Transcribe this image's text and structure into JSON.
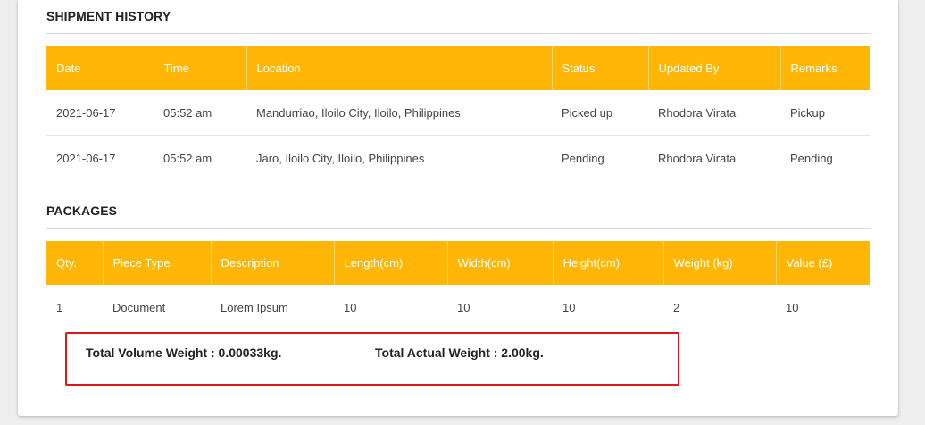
{
  "shipment_history": {
    "title": "SHIPMENT HISTORY",
    "columns": [
      "Date",
      "Time",
      "Location",
      "Status",
      "Updated By",
      "Remarks"
    ],
    "rows": [
      [
        "2021-06-17",
        "05:52 am",
        "Mandurriao, Iloilo City, Iloilo, Philippines",
        "Picked up",
        "Rhodora Virata",
        "Pickup"
      ],
      [
        "2021-06-17",
        "05:52 am",
        "Jaro, Iloilo City, Iloilo, Philippines",
        "Pending",
        "Rhodora Virata",
        "Pending"
      ]
    ]
  },
  "packages": {
    "title": "PACKAGES",
    "columns": [
      "Qty.",
      "Piece Type",
      "Description",
      "Length(cm)",
      "Width(cm)",
      "Height(cm)",
      "Weight (kg)",
      "Value (£)"
    ],
    "rows": [
      [
        "1",
        "Document",
        "Lorem Ipsum",
        "10",
        "10",
        "10",
        "2",
        "10"
      ]
    ]
  },
  "totals": {
    "volume_weight": "Total Volume Weight : 0.00033kg.",
    "actual_weight": "Total Actual Weight : 2.00kg."
  },
  "colors": {
    "header_bg": "#ffb606",
    "highlight_border": "#e2141b"
  }
}
